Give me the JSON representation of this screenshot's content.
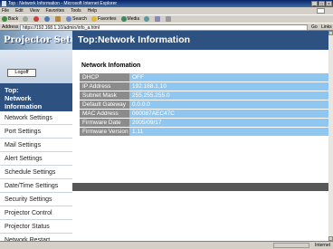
{
  "window": {
    "title": "Top : Network Information - Microsoft Internet Explorer",
    "controls": [
      "_",
      "□",
      "×"
    ]
  },
  "menu": [
    "File",
    "Edit",
    "View",
    "Favorites",
    "Tools",
    "Help"
  ],
  "toolbar": {
    "back": "Back",
    "search": "Search",
    "favorites": "Favorites",
    "media": "Media"
  },
  "address": {
    "label": "Address",
    "url": "https://192.168.1.10/admin/info_a.html",
    "go": "Go",
    "links": "Links"
  },
  "app": {
    "brand": "Projector Setup",
    "page_title": "Top:Network Information",
    "logoff": "Logoff",
    "current_section": "Top:\nNetwork\nInformation"
  },
  "sidebar": {
    "current_lines": [
      "Top:",
      "Network",
      "Information"
    ],
    "items": [
      {
        "label": "Network Settings"
      },
      {
        "label": "Port Settings"
      },
      {
        "label": "Mail Settings"
      },
      {
        "label": "Alert Settings"
      },
      {
        "label": "Schedule Settings"
      },
      {
        "label": "Date/Time Settings"
      },
      {
        "label": "Security Settings"
      },
      {
        "label": "Projector Control"
      },
      {
        "label": "Projector Status"
      },
      {
        "label": "Network Restart"
      }
    ]
  },
  "network_info": {
    "section_title": "Network Infomation",
    "rows": [
      {
        "key": "DHCP",
        "value": "OFF"
      },
      {
        "key": "IP Address",
        "value": "192.168.1.10"
      },
      {
        "key": "Subnet Mask",
        "value": "255.255.255.0"
      },
      {
        "key": "Default Gateway",
        "value": "0.0.0.0"
      },
      {
        "key": "MAC Address",
        "value": "000087AEC47C"
      },
      {
        "key": "Firmware Date",
        "value": "2005/09/17"
      },
      {
        "key": "Firmware Version",
        "value": "1.11"
      }
    ]
  },
  "status": {
    "zone": "Internet"
  },
  "colors": {
    "header_navy": "#2d5282",
    "key_gray": "#8c8c8c",
    "value_blue": "#8fc7f0"
  }
}
